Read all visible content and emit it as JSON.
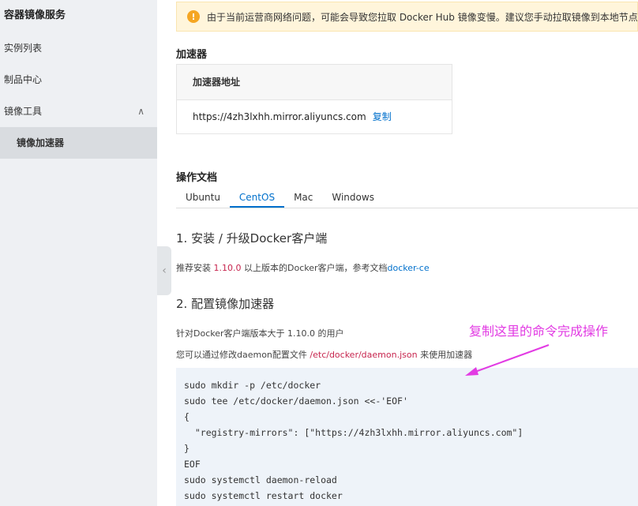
{
  "sidebar": {
    "title": "容器镜像服务",
    "items": [
      {
        "label": "实例列表"
      },
      {
        "label": "制品中心"
      },
      {
        "label": "镜像工具",
        "chevron": "∧"
      },
      {
        "label": "镜像加速器"
      }
    ]
  },
  "banner": {
    "icon": "!",
    "text": "由于当前运营商网络问题，可能会导致您拉取 Docker Hub 镜像变慢。建议您手动拉取镜像到本地节点，"
  },
  "accelerator": {
    "section_title": "加速器",
    "header": "加速器地址",
    "address": "https://4zh3lxhh.mirror.aliyuncs.com",
    "copy_label": "复制"
  },
  "docs": {
    "section_title": "操作文档",
    "tabs": [
      "Ubuntu",
      "CentOS",
      "Mac",
      "Windows"
    ],
    "active_tab": "CentOS",
    "step1_title": "1. 安装 / 升级Docker客户端",
    "step1_text_a": "推荐安装 ",
    "step1_version": "1.10.0",
    "step1_text_b": " 以上版本的Docker客户端，参考文档",
    "step1_link": "docker-ce",
    "step2_title": "2. 配置镜像加速器",
    "step2_text1": "针对Docker客户端版本大于 1.10.0 的用户",
    "step2_text2_a": "您可以通过修改daemon配置文件 ",
    "step2_path": "/etc/docker/daemon.json",
    "step2_text2_b": " 来使用加速器",
    "code_lines": [
      "sudo mkdir -p /etc/docker",
      "sudo tee /etc/docker/daemon.json <<-'EOF'",
      "{",
      "  \"registry-mirrors\": [\"https://4zh3lxhh.mirror.aliyuncs.com\"]",
      "}",
      "EOF",
      "sudo systemctl daemon-reload",
      "sudo systemctl restart docker"
    ]
  },
  "annotation": {
    "text": "复制这里的命令完成操作",
    "color": "#e23be3"
  }
}
